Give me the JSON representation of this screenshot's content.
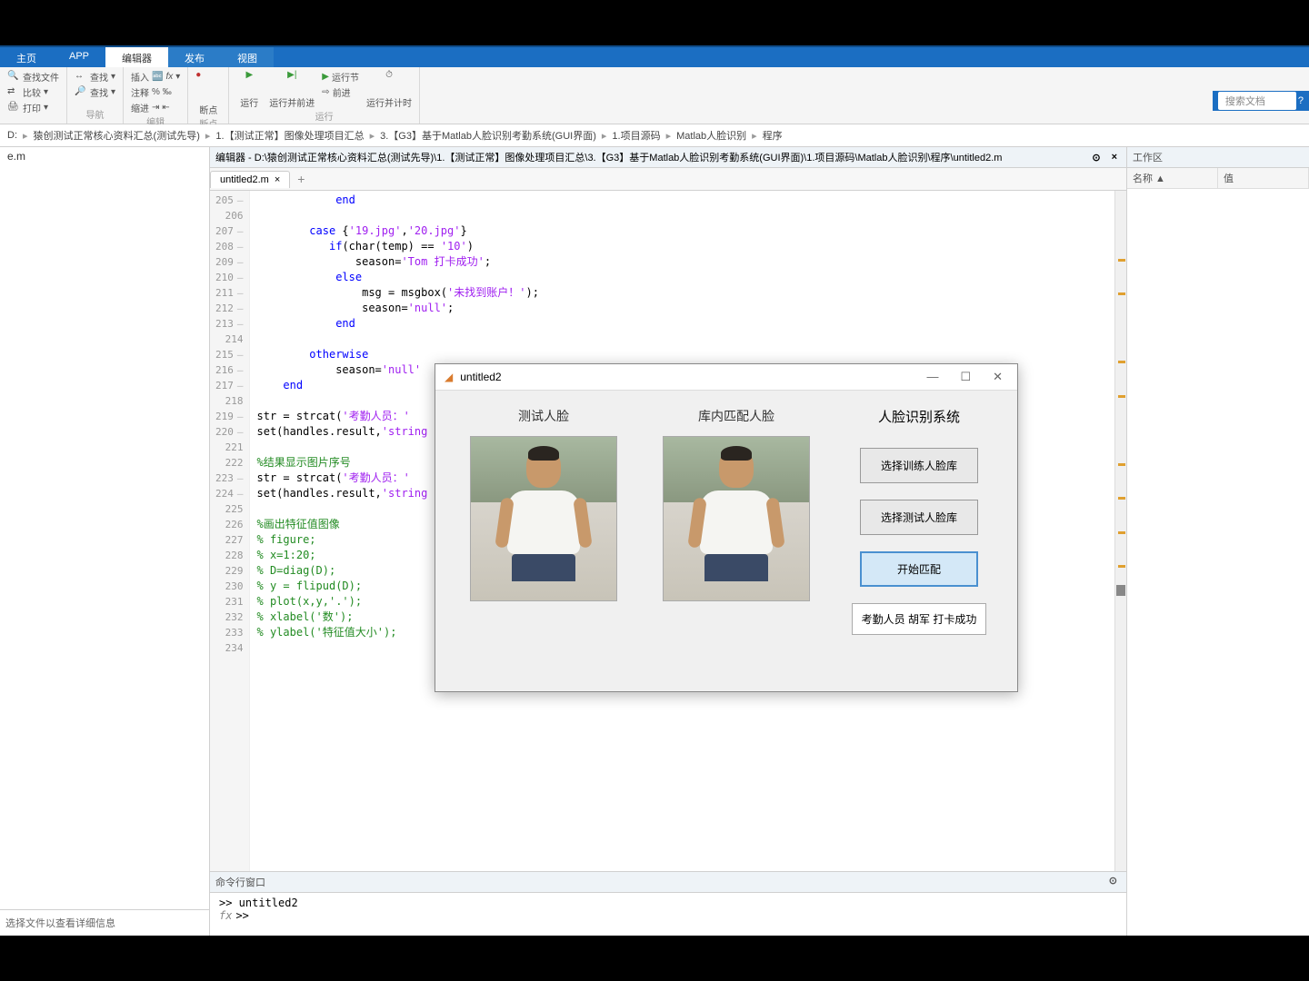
{
  "ribbon_tabs": {
    "home": "主页",
    "app": "APP",
    "editor": "编辑器",
    "publish": "发布",
    "view": "视图"
  },
  "ribbon": {
    "find_file": "查找文件",
    "compare": "比较",
    "print": "打印",
    "goto": "查找",
    "nav_label": "导航",
    "insert": "插入",
    "fx": "fx",
    "comment": "注释",
    "indent": "缩进",
    "edit_label": "编辑",
    "bp": "断点",
    "bp_label": "断点",
    "run": "运行",
    "run_advance": "运行并前进",
    "run_section": "运行节",
    "advance": "前进",
    "run_time": "运行并计时",
    "run_label": "运行"
  },
  "titlebar_search": "搜索文档",
  "breadcrumb": [
    "D:",
    "猿创测试正常核心资料汇总(测试先导)",
    "1.【测试正常】图像处理项目汇总",
    "3.【G3】基于Matlab人脸识别考勤系统(GUI界面)",
    "1.项目源码",
    "Matlab人脸识别",
    "程序"
  ],
  "editor_title": "编辑器 - D:\\猿创测试正常核心资料汇总(测试先导)\\1.【测试正常】图像处理项目汇总\\3.【G3】基于Matlab人脸识别考勤系统(GUI界面)\\1.项目源码\\Matlab人脸识别\\程序\\untitled2.m",
  "tab": {
    "name": "untitled2.m"
  },
  "left": {
    "file": "e.m",
    "hint": "选择文件以查看详细信息"
  },
  "code": {
    "lines": [
      205,
      206,
      207,
      208,
      209,
      210,
      211,
      212,
      213,
      214,
      215,
      216,
      217,
      218,
      219,
      220,
      221,
      222,
      223,
      224,
      225,
      226,
      227,
      228,
      229,
      230,
      231,
      232,
      233,
      234
    ],
    "l205": "            end",
    "l206": "",
    "l207": "        case {'19.jpg','20.jpg'}",
    "l208": "           if(char(temp) == '10')",
    "l209": "               season='Tom 打卡成功';",
    "l210": "            else",
    "l211": "                msg = msgbox('未找到账户！');",
    "l212": "                season='null';",
    "l213": "            end",
    "l214": "",
    "l215": "        otherwise",
    "l216": "            season='null'",
    "l217": "    end",
    "l218": "",
    "l219": "str = strcat('考勤人员：'",
    "l220": "set(handles.result,'string",
    "l221": "",
    "l222": "%结果显示图片序号",
    "l223": "str = strcat('考勤人员：'",
    "l224": "set(handles.result,'string",
    "l225": "",
    "l226": "%画出特征值图像",
    "l227": "% figure;",
    "l228": "% x=1:20;",
    "l229": "% D=diag(D);",
    "l230": "% y = flipud(D);",
    "l231": "% plot(x,y,'.');",
    "l232": "% xlabel('数');",
    "l233": "% ylabel('特征值大小');",
    "l234": ""
  },
  "cmd": {
    "title": "命令行窗口",
    "line1": ">> untitled2",
    "line2": ">> "
  },
  "workspace": {
    "title": "工作区",
    "col1": "名称 ▲",
    "col2": "值"
  },
  "fig": {
    "title": "untitled2",
    "test_label": "测试人脸",
    "match_label": "库内匹配人脸",
    "sys_title": "人脸识别系统",
    "btn1": "选择训练人脸库",
    "btn2": "选择测试人脸库",
    "btn3": "开始匹配",
    "result": "考勤人员 胡军 打卡成功"
  }
}
